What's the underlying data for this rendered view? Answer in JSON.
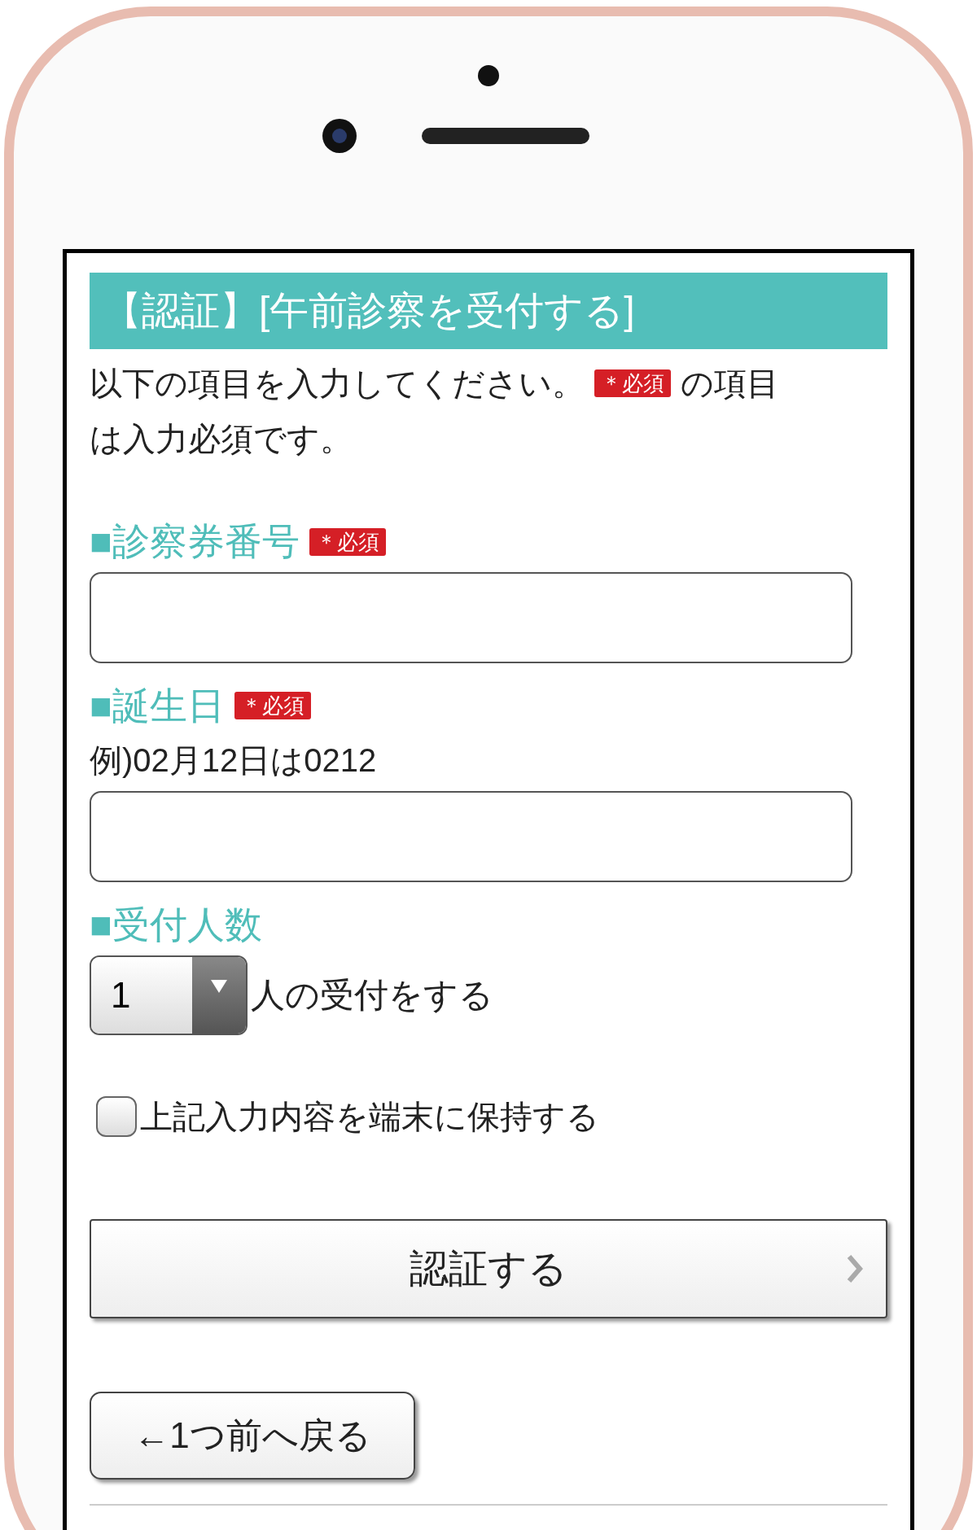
{
  "header": {
    "title": "【認証】[午前診察を受付する]"
  },
  "intro": {
    "before": "以下の項目を入力してください。",
    "badge": "＊必須",
    "after": "の項目",
    "line2": "は入力必須です。"
  },
  "fields": [
    {
      "kind": "text",
      "label": "■診察券番号",
      "badge": "＊必須"
    },
    {
      "kind": "text",
      "label": "■誕生日",
      "badge": "＊必須",
      "hint": "例)02月12日は0212"
    },
    {
      "kind": "select",
      "label": "■受付人数",
      "value": "1",
      "suffix": "人の受付をする"
    }
  ],
  "remember": {
    "label": "上記入力内容を端末に保持する",
    "checked": false
  },
  "submit": {
    "label": "認証する"
  },
  "back": {
    "label": "←1つ前へ戻る"
  }
}
